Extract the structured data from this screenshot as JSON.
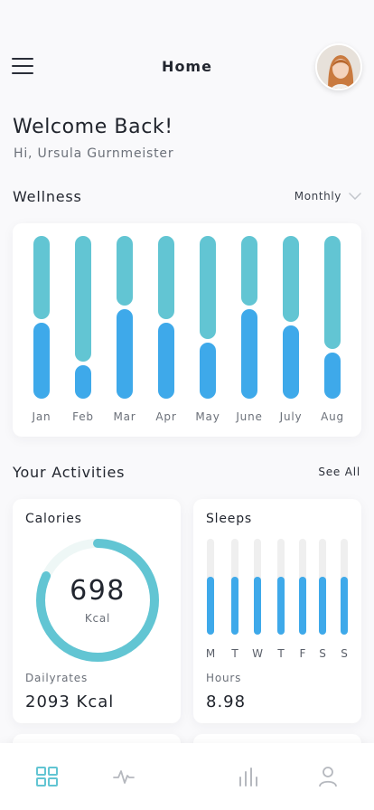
{
  "header": {
    "title": "Home"
  },
  "welcome": {
    "title": "Welcome Back!",
    "greeting": "Hi, Ursula Gurnmeister"
  },
  "wellness": {
    "title": "Wellness",
    "period": "Monthly"
  },
  "chart_data": {
    "type": "bar",
    "categories": [
      "Jan",
      "Feb",
      "Mar",
      "Apr",
      "May",
      "June",
      "July",
      "Aug"
    ],
    "series": [
      {
        "values": [
          0.48,
          0.21,
          0.56,
          0.48,
          0.35,
          0.56,
          0.46,
          0.29
        ]
      },
      {
        "values": [
          0.52,
          0.79,
          0.44,
          0.52,
          0.65,
          0.44,
          0.54,
          0.71
        ]
      }
    ],
    "colors": [
      "#3ea9ea",
      "#62c5d3"
    ]
  },
  "activities": {
    "title": "Your Activities",
    "see_all": "See All"
  },
  "calories": {
    "title": "Calories",
    "value": "698",
    "unit": "Kcal",
    "progress": 0.82,
    "sub_label": "Dailyrates",
    "daily_value": "2093 Kcal"
  },
  "sleeps": {
    "title": "Sleeps",
    "days": [
      "M",
      "T",
      "W",
      "T",
      "F",
      "S",
      "S"
    ],
    "levels": [
      0.6,
      0.6,
      0.6,
      0.6,
      0.6,
      0.6,
      0.6
    ],
    "sub_label": "Hours",
    "hours": "8.98"
  },
  "colors": {
    "accent_dark": "#3ea9ea",
    "accent_light": "#62c5d3",
    "tab_active": "#62c5d3",
    "tab_inactive": "#b5b8be"
  },
  "tabs": [
    {
      "icon": "dashboard-icon",
      "active": true
    },
    {
      "icon": "activity-icon",
      "active": false
    },
    {
      "icon": "stats-icon",
      "active": false
    },
    {
      "icon": "profile-icon",
      "active": false
    }
  ]
}
